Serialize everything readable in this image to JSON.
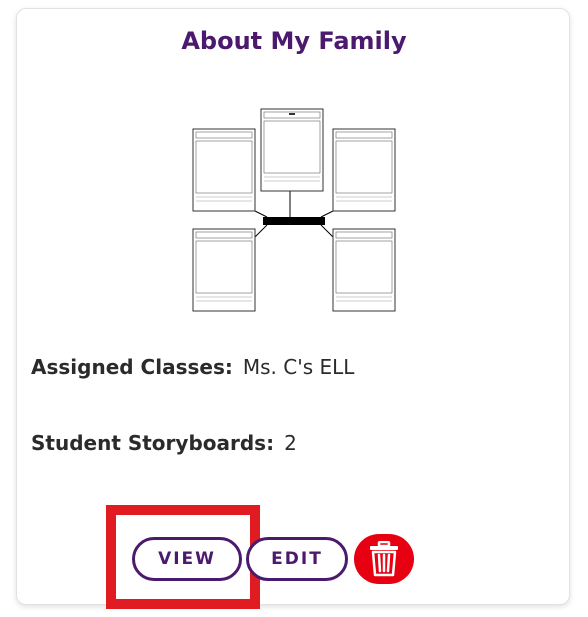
{
  "card": {
    "title": "About My Family",
    "assigned_classes_label": "Assigned Classes:",
    "assigned_classes_value": "Ms. C's ELL",
    "student_storyboards_label": "Student Storyboards:",
    "student_storyboards_value": "2"
  },
  "buttons": {
    "view_label": "VIEW",
    "edit_label": "EDIT",
    "delete_icon": "trash-icon"
  },
  "colors": {
    "accent": "#4b1a6e",
    "highlight": "#e01b22",
    "delete": "#e60012"
  }
}
